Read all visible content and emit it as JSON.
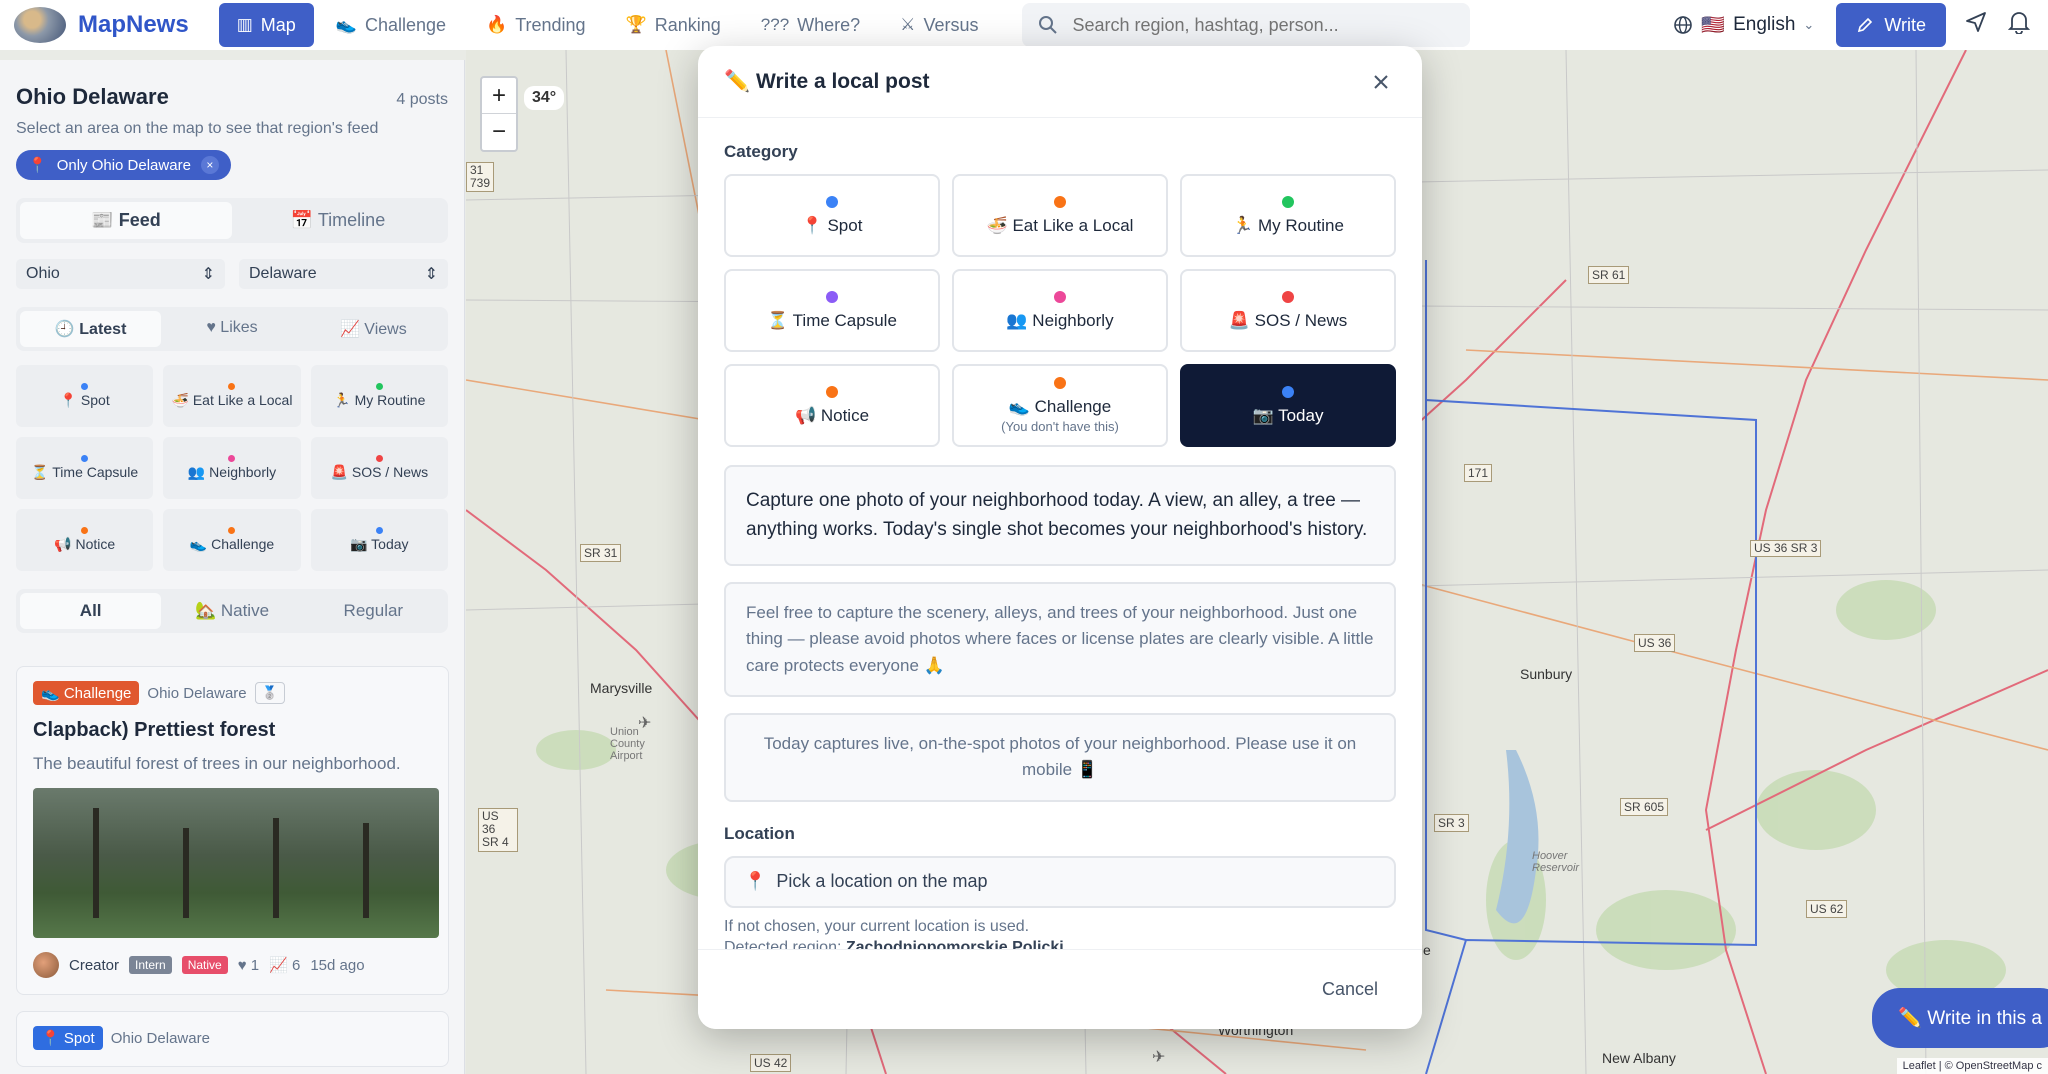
{
  "app": {
    "logo_text": "MapNews",
    "nav": [
      {
        "icon": "▥",
        "label": "Map"
      },
      {
        "icon": "👟",
        "label": "Challenge"
      },
      {
        "icon": "🔥",
        "label": "Trending"
      },
      {
        "icon": "🏆",
        "label": "Ranking"
      },
      {
        "icon": "???",
        "label": "Where?"
      },
      {
        "icon": "⚔",
        "label": "Versus"
      }
    ],
    "search_placeholder": "Search region, hashtag, person...",
    "language": "English",
    "language_flag": "🇺🇸",
    "write_label": "Write"
  },
  "sidebar": {
    "title": "Ohio Delaware",
    "post_count": "4 posts",
    "subtitle": "Select an area on the map to see that region's feed",
    "chip_label": "Only Ohio Delaware",
    "chip_icon": "📍",
    "view_tabs": [
      "📰 Feed",
      "📅 Timeline"
    ],
    "state_select": "Ohio",
    "county_select": "Delaware",
    "sort_tabs": [
      "🕘 Latest",
      "♥ Likes",
      "📈 Views"
    ],
    "categories": [
      {
        "label": "📍 Spot",
        "color": "#3b82f6"
      },
      {
        "label": "🍜 Eat Like a Local",
        "color": "#f97316"
      },
      {
        "label": "🏃 My Routine",
        "color": "#22c55e"
      },
      {
        "label": "⏳ Time Capsule",
        "color": "#3b82f6"
      },
      {
        "label": "👥 Neighborly",
        "color": "#ec4899"
      },
      {
        "label": "🚨 SOS / News",
        "color": "#ef4444"
      },
      {
        "label": "📢 Notice",
        "color": "#f97316"
      },
      {
        "label": "👟 Challenge",
        "color": "#f97316"
      },
      {
        "label": "📷 Today",
        "color": "#3b82f6"
      }
    ],
    "type_tabs": [
      "All",
      "🏡 Native",
      "Regular"
    ],
    "posts": [
      {
        "tag": "👟 Challenge",
        "region": "Ohio Delaware",
        "medal": "🥈",
        "title": "Clapback) Prettiest forest",
        "desc": "The beautiful forest of trees in our neighborhood.",
        "author": "Creator",
        "badge1": "Intern",
        "badge2": "Native",
        "likes": "♥ 1",
        "views": "📈 6",
        "age": "15d ago"
      },
      {
        "tag": "📍 Spot",
        "region": "Ohio Delaware"
      }
    ]
  },
  "map": {
    "temperature": "34°",
    "zoom_in": "+",
    "zoom_out": "−",
    "write_here": "✏️ Write in this a",
    "attribution": "Leaflet | © OpenStreetMap c",
    "labels": [
      "SR 61",
      "US 36 SR 3",
      "US 36",
      "SR 31",
      "SR 605",
      "US 62",
      "SR 3",
      "US 36 SR 4",
      "US 42",
      "31 739",
      "171"
    ],
    "towns": [
      "Marysville",
      "Sunbury",
      "Union County Airport",
      "Hoover Reservoir",
      "New Albany",
      "Worthington",
      "rville"
    ]
  },
  "modal": {
    "title_icon": "✏️",
    "title": "Write a local post",
    "category_label": "Category",
    "categories": [
      {
        "label": "📍 Spot",
        "color": "#3b82f6",
        "sub": ""
      },
      {
        "label": "🍜 Eat Like a Local",
        "color": "#f97316",
        "sub": ""
      },
      {
        "label": "🏃 My Routine",
        "color": "#22c55e",
        "sub": ""
      },
      {
        "label": "⏳ Time Capsule",
        "color": "#8b5cf6",
        "sub": ""
      },
      {
        "label": "👥 Neighborly",
        "color": "#ec4899",
        "sub": ""
      },
      {
        "label": "🚨 SOS / News",
        "color": "#ef4444",
        "sub": ""
      },
      {
        "label": "📢 Notice",
        "color": "#f97316",
        "sub": ""
      },
      {
        "label": "👟 Challenge",
        "color": "#f97316",
        "sub": "(You don't have this)"
      },
      {
        "label": "📷 Today",
        "color": "#3b82f6",
        "sub": "",
        "selected": true
      }
    ],
    "description": "Capture one photo of your neighborhood today. A view, an alley, a tree — anything works. Today's single shot becomes your neighborhood's history.",
    "guidance": "Feel free to capture the scenery, alleys, and trees of your neighborhood. Just one thing — please avoid photos where faces or license plates are clearly visible. A little care protects everyone 🙏",
    "mobile_note": "Today captures live, on-the-spot photos of your neighborhood. Please use it on mobile 📱",
    "location_label": "Location",
    "location_placeholder": "Pick a location on the map",
    "location_icon": "📍",
    "hint_line": "If not chosen, your current location is used.",
    "detected_label": "Detected region:",
    "detected_region": "Zachodniopomorskie Policki",
    "cancel_label": "Cancel"
  }
}
